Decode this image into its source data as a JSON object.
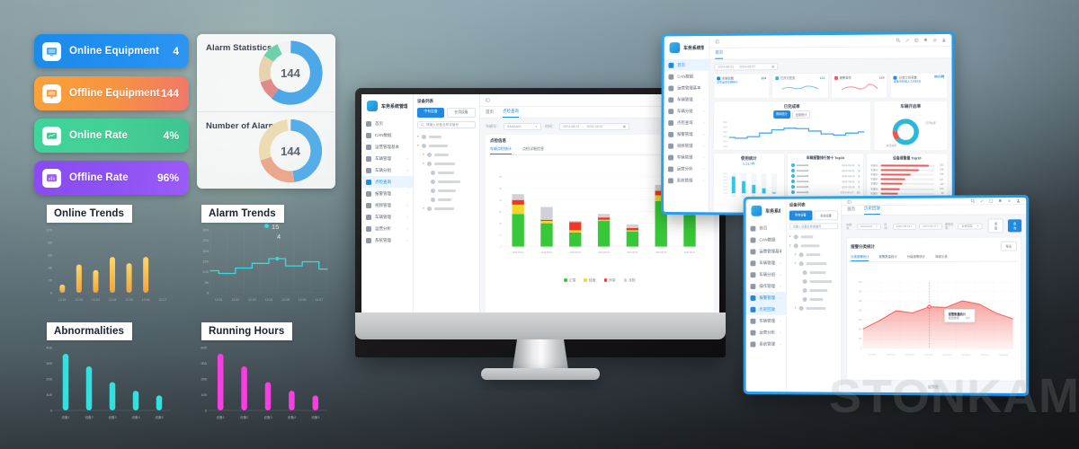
{
  "background": {
    "watermark_text": "STONKAM",
    "watermark_mark": "®"
  },
  "stat_cards": [
    {
      "label": "Online Equipment",
      "value": "4",
      "color": "#1f8ff0",
      "icon": "monitor-icon"
    },
    {
      "label": "Offline Equipment",
      "value": "144",
      "color": "#f79340",
      "icon": "monitor-off-icon"
    },
    {
      "label": "Online Rate",
      "value": "4%",
      "color": "#44cf95",
      "icon": "gauge-icon"
    },
    {
      "label": "Offline Rate",
      "value": "96%",
      "color": "#8d52f3",
      "icon": "chart-icon"
    }
  ],
  "alarm_panel": {
    "blocks": [
      {
        "title": "Alarm Statistics",
        "center_value": "144"
      },
      {
        "title": "Number of Alarms",
        "center_value": "144"
      }
    ]
  },
  "mini_charts": {
    "online_trends": {
      "title": "Online Trends",
      "chart_data": {
        "type": "bar",
        "title": "Online Trends",
        "categories": [
          "12:01",
          "12:02",
          "12:03",
          "12:04",
          "12:05",
          "12:06",
          "12:07"
        ],
        "values": [
          13,
          45,
          36,
          57,
          47,
          57,
          0
        ],
        "ylim": [
          0,
          100
        ],
        "yticks": [
          "100",
          "80",
          "60",
          "40",
          "20",
          "0"
        ],
        "color": "#f5b33c",
        "grid": false,
        "legend": "none"
      }
    },
    "alarm_trends": {
      "title": "Alarm Trends",
      "tooltip": {
        "value": "15",
        "sub": "4"
      },
      "chart_data": {
        "type": "line",
        "title": "Alarm Trends",
        "categories": [
          "12:01",
          "12:02",
          "12:03",
          "12:04",
          "12:05",
          "12:06",
          "12:07"
        ],
        "values": [
          105,
          92,
          118,
          140,
          163,
          128,
          148,
          113
        ],
        "ylim": [
          0,
          300
        ],
        "yticks": [
          "300",
          "250",
          "200",
          "150",
          "100",
          "50",
          "0"
        ],
        "color": "#33dde0",
        "grid": true,
        "legend": "none"
      }
    },
    "abnormalities": {
      "title": "Abnormalities",
      "chart_data": {
        "type": "bar",
        "title": "Abnormalities",
        "categories": [
          "设备1",
          "设备2",
          "设备3",
          "设备4",
          "设备5"
        ],
        "values": [
          360,
          280,
          180,
          125,
          95
        ],
        "ylim": [
          0,
          400
        ],
        "yticks": [
          "400",
          "300",
          "200",
          "100",
          "0"
        ],
        "color": "#33e0e0",
        "grid": false,
        "legend": "none"
      }
    },
    "running_hours": {
      "title": "Running Hours",
      "chart_data": {
        "type": "bar",
        "title": "Running Hours",
        "categories": [
          "设备1",
          "设备2",
          "设备3",
          "设备4",
          "设备5"
        ],
        "values": [
          360,
          280,
          180,
          125,
          95
        ],
        "ylim": [
          0,
          400
        ],
        "yticks": [
          "400",
          "300",
          "200",
          "100",
          "0"
        ],
        "color": "#f53fe0",
        "grid": false,
        "legend": "none"
      }
    }
  },
  "monitor": {
    "brand": "车务系统管理平台",
    "sidebar": [
      {
        "label": "首页",
        "arrow": ""
      },
      {
        "label": "CAN数据",
        "arrow": ""
      },
      {
        "label": "运营管理基本",
        "arrow": ""
      },
      {
        "label": "车辆管理",
        "arrow": "›"
      },
      {
        "label": "车辆分组",
        "arrow": "›"
      },
      {
        "label": "点检查询",
        "arrow": "",
        "active": true
      },
      {
        "label": "报警管理",
        "arrow": "›"
      },
      {
        "label": "视频管理",
        "arrow": "›"
      },
      {
        "label": "车辆管理",
        "arrow": "›"
      },
      {
        "label": "运营分析",
        "arrow": "›"
      },
      {
        "label": "系统管理",
        "arrow": "›"
      }
    ],
    "tabs": [
      {
        "label": "首页",
        "active": false
      },
      {
        "label": "点检查询",
        "active": true
      }
    ],
    "tree_header": "设备列表",
    "tree_buttons": [
      {
        "label": "中有设备",
        "active": true
      },
      {
        "label": "在用设备",
        "active": false
      }
    ],
    "tree_search_placeholder": "请输入设备名称或编号",
    "filters": [
      {
        "label": "车辆号：",
        "value": "AAAAA01"
      },
      {
        "label": "时间：",
        "value": "2024-08-01"
      },
      {
        "label": "",
        "value": "2024-08-07"
      }
    ],
    "section_title": "点检信息",
    "sub_tabs": [
      {
        "label": "车辆点检统计",
        "active": true
      },
      {
        "label": "点检详细信息",
        "active": false
      }
    ],
    "chart_data": {
      "type": "bar",
      "subtype": "stacked",
      "title": "车辆点检统计",
      "categories": [
        "2024-08-01",
        "2024-08-02",
        "2024-08-03",
        "2024-08-04",
        "2024-08-05",
        "2024-08-06",
        "2024-08-07"
      ],
      "series": [
        {
          "name": "正常",
          "color": "#37c837",
          "values": [
            28,
            20,
            12,
            22,
            13,
            39,
            27
          ]
        },
        {
          "name": "轻微",
          "color": "#f6d529",
          "values": [
            8,
            2,
            2,
            1,
            1,
            5,
            1
          ]
        },
        {
          "name": "异常",
          "color": "#f2352a",
          "values": [
            4,
            1,
            7,
            2,
            2,
            4,
            2
          ]
        },
        {
          "name": "未检",
          "color": "#cfd3d7",
          "values": [
            5,
            11,
            1,
            3,
            3,
            5,
            1
          ]
        }
      ],
      "ylim": [
        0,
        60
      ],
      "yticks": [
        "60",
        "50",
        "40",
        "30",
        "20",
        "10",
        "0"
      ],
      "legend": "bottom"
    }
  },
  "laptop": {
    "brand": "车务系统管理平台",
    "sidebar": [
      {
        "label": "首页",
        "active": true
      },
      {
        "label": "CAN数据"
      },
      {
        "label": "运营管理基本"
      },
      {
        "label": "车辆管理",
        "arrow": "›"
      },
      {
        "label": "车辆分组",
        "arrow": "›"
      },
      {
        "label": "点检查询",
        "arrow": "›"
      },
      {
        "label": "报警管理",
        "arrow": "›"
      },
      {
        "label": "视频管理",
        "arrow": "›"
      },
      {
        "label": "车辆管理",
        "arrow": "›"
      },
      {
        "label": "运营分析",
        "arrow": "›"
      },
      {
        "label": "系统管理",
        "arrow": "›"
      }
    ],
    "tabs": [
      {
        "label": "首页",
        "active": true
      }
    ],
    "date_range": {
      "from": "2024-08-01",
      "to": "2024-08-07"
    },
    "stat_tiles": [
      {
        "label": "车辆总数",
        "value": "124",
        "sub": "正在运营车辆统计",
        "icon": "car-icon",
        "color": "#1f8ae0",
        "spark": "none"
      },
      {
        "label": "已开行任务",
        "value": "124",
        "sub": "",
        "icon": "clock-icon",
        "color": "#35b6e8",
        "spark": "blue"
      },
      {
        "label": "报警事件",
        "value": "124",
        "sub": "",
        "icon": "alarm-icon",
        "color": "#f05a5a",
        "spark": "red"
      },
      {
        "label": "已完工任务数",
        "value": "80小时",
        "sub": "运输中机电人工作时长",
        "icon": "bars-icon",
        "color": "#1f8ae0",
        "spark": "none"
      }
    ],
    "line_card": {
      "title": "已完成率",
      "badge_active": "期间统计",
      "badge_other": "全部统计",
      "chart_data": {
        "type": "line",
        "title": "已完成率",
        "x": [
          "1",
          "2",
          "3",
          "4",
          "5",
          "6",
          "7",
          "8",
          "9",
          "10",
          "11",
          "12"
        ],
        "values": [
          22,
          20,
          24,
          33,
          41,
          45,
          44,
          38,
          31,
          28,
          33,
          36
        ],
        "ylim": [
          0,
          60
        ],
        "yticks": [
          "60%",
          "50%",
          "40%",
          "30%",
          "20%",
          "10%"
        ],
        "color": "#4aa8e8"
      }
    },
    "donut_card": {
      "title": "车辆开启率",
      "chart_data": {
        "type": "pie",
        "title": "车辆开启率",
        "labels": [
          "已开启",
          "未开启"
        ],
        "values": [
          88,
          12
        ],
        "colors": [
          "#2bb8d8",
          "#f2544a"
        ],
        "annotations": [
          "已开启率",
          "未开启率"
        ]
      }
    },
    "bar_card": {
      "title": "使用统计",
      "subtitle": "1,217件",
      "chart_data": {
        "type": "bar",
        "title": "使用统计",
        "categories": [
          "08-01",
          "08-02",
          "08-03"
        ],
        "values": [
          295,
          215,
          150,
          90,
          18
        ],
        "ylim": [
          0,
          350
        ],
        "yticks": [
          "350.00",
          "300.00",
          "250.00",
          "200.00",
          "150.00",
          "100.00",
          "50.00"
        ],
        "color": "#2bc8e8"
      }
    },
    "list_card": {
      "title": "车辆报警排行前十 Top10",
      "rows": [
        {
          "name": "AAAAA01",
          "date": "2024-08-01",
          "badge": "9"
        },
        {
          "name": "AAAAA02",
          "date": "2024-08-02",
          "badge": "8"
        },
        {
          "name": "AAAAA03",
          "date": "2024-08-03",
          "badge": "6"
        },
        {
          "name": "AAAAA04",
          "date": "2024-08-05",
          "badge": "5"
        },
        {
          "name": "AAAAA05",
          "date": "2024-08-06",
          "badge": "3"
        },
        {
          "name": "AAAAA06",
          "date": "2024-08-07",
          "badge": "10"
        }
      ]
    },
    "rank_card": {
      "title": "设备报警量 Top10",
      "chart_data": {
        "type": "bar",
        "subtype": "horizontal",
        "title": "设备报警量 Top10",
        "categories": [
          "车辆01",
          "车辆02",
          "车辆03",
          "车辆04",
          "车辆05",
          "车辆06",
          "车辆07"
        ],
        "values": [
          253,
          198,
          156,
          127,
          113,
          102,
          90
        ],
        "ylim": [
          0,
          280
        ],
        "color": "#f05a5a"
      }
    }
  },
  "tablet": {
    "brand": "车务系统管理平台",
    "sidebar": [
      {
        "label": "首页"
      },
      {
        "label": "CAN数据"
      },
      {
        "label": "运营管理基本"
      },
      {
        "label": "车辆管理",
        "arrow": "›"
      },
      {
        "label": "车辆分组",
        "arrow": "›"
      },
      {
        "label": "操作管理",
        "arrow": "›"
      },
      {
        "label": "报警管理",
        "arrow": "›",
        "active": true
      },
      {
        "label": "历史回放",
        "active2": true
      },
      {
        "label": "车辆管理",
        "arrow": "›"
      },
      {
        "label": "运营分析",
        "arrow": "›"
      },
      {
        "label": "系统管理",
        "arrow": "›"
      }
    ],
    "tabs": [
      {
        "label": "首页",
        "active": false
      },
      {
        "label": "历史回放",
        "active": true
      }
    ],
    "tree_header": "设备列表",
    "tree_buttons": [
      {
        "label": "所有设备",
        "active": true
      },
      {
        "label": "在线设备",
        "active": false
      }
    ],
    "tree_search_placeholder": "请输入设备名称或编号",
    "filters": [
      {
        "label": "车辆号：",
        "value": "AAAAA01"
      },
      {
        "label": "时间：",
        "value": "2024-08-01"
      },
      {
        "label": "",
        "value": "2024-08-07"
      },
      {
        "label": "报警类型：",
        "value": "全部类型"
      }
    ],
    "filter_buttons": [
      {
        "label": "重置",
        "primary": false
      },
      {
        "label": "查询",
        "primary": true
      }
    ],
    "section_title": "报警分类统计",
    "export_button": "导出",
    "sub_tabs": [
      {
        "label": "分类报警统计",
        "active": true
      },
      {
        "label": "报警数量统计",
        "active": false
      },
      {
        "label": "分级报警统计",
        "active": false
      },
      {
        "label": "驾驶记录",
        "active": false
      }
    ],
    "tooltip": {
      "title": "报警数量统计",
      "row_label": "报警数量",
      "row_value": "312"
    },
    "footer": "报警数",
    "chart_data": {
      "type": "area",
      "title": "报警分类统计",
      "categories": [
        "2024-08-01",
        "2024-08-02",
        "2024-08-03",
        "2024-08-04",
        "2024-08-05",
        "2024-08-06",
        "2024-08-07",
        "2024-08-08"
      ],
      "values": [
        118,
        168,
        228,
        215,
        252,
        248,
        288,
        268,
        215,
        180
      ],
      "ylim": [
        0,
        400
      ],
      "yticks": [
        "400",
        "350",
        "300",
        "250",
        "200",
        "150",
        "100",
        "0"
      ],
      "color": "#f2554d",
      "crosshair_x": "2024-08-04"
    }
  }
}
